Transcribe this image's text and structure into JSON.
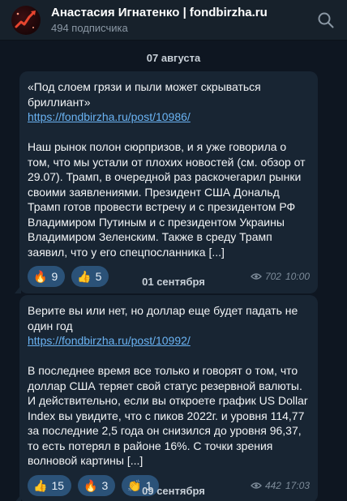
{
  "header": {
    "channel_name": "Анастасия Игнатенко | fondbirzha.ru",
    "subscribers": "494 подписчика",
    "search_icon": "search-icon"
  },
  "dates": [
    "07 августа",
    "01 сентября",
    "09 сентября"
  ],
  "messages": [
    {
      "title": "«Под слоем грязи и пыли может скрываться бриллиант»",
      "link": "https://fondbirzha.ru/post/10986/",
      "body": "Наш рынок полон сюрпризов, и я уже говорила о том, что мы устали от плохих новостей (см. обзор от 29.07). Трамп, в очередной раз раскочегарил рынки своими заявлениями. Президент США Дональд Трамп готов провести встречу и с президентом РФ Владимиром Путиным и с президентом Украины Владимиром Зеленским. Также в среду Трамп заявил, что у его спецпосланника [...]",
      "reactions": [
        {
          "emoji": "🔥",
          "count": "9"
        },
        {
          "emoji": "👍",
          "count": "5"
        }
      ],
      "views": "702",
      "time": "10:00"
    },
    {
      "title": "Верите вы или нет, но доллар еще будет падать не один год",
      "link": "https://fondbirzha.ru/post/10992/",
      "body": "В последнее время все только и говорят о том, что доллар США теряет свой статус резервной валюты. И действительно, если вы откроете график US Dollar Index вы увидите, что с пиков 2022г. и уровня 114,77 за последние 2,5 года он снизился до уровня 96,37, то есть потерял в районе 16%. С точки зрения волновой картины [...]",
      "reactions": [
        {
          "emoji": "👍",
          "count": "15"
        },
        {
          "emoji": "🔥",
          "count": "3"
        },
        {
          "emoji": "👏",
          "count": "1"
        }
      ],
      "views": "442",
      "time": "17:03"
    }
  ],
  "colors": {
    "background": "#0e1621",
    "header": "#17212b",
    "bubble": "#182533",
    "link": "#6ab3f3",
    "reaction": "#2b5278"
  }
}
